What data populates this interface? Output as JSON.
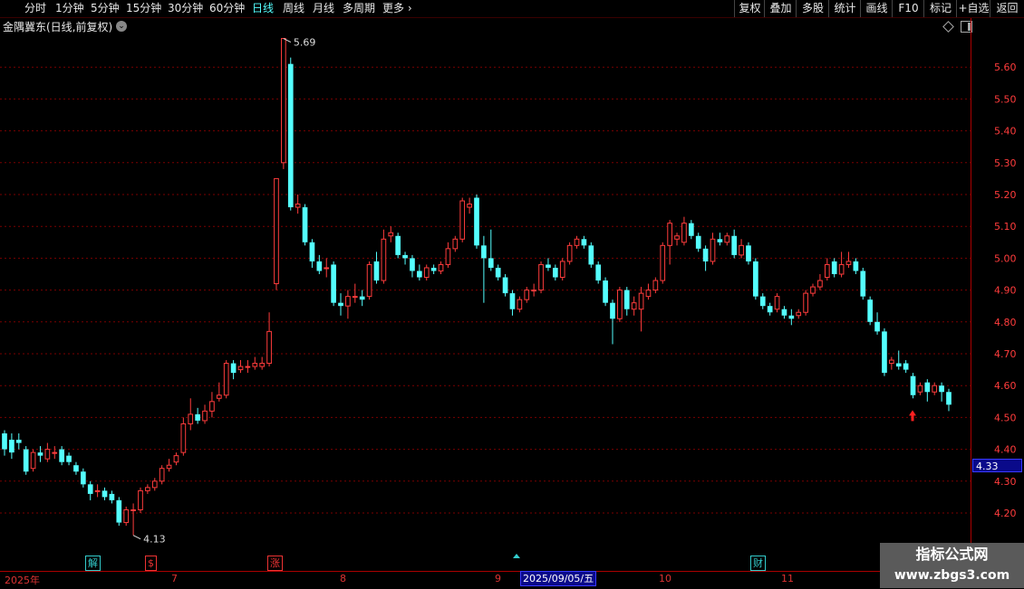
{
  "toolbar": {
    "periods": [
      "分时",
      "1分钟",
      "5分钟",
      "15分钟",
      "30分钟",
      "60分钟",
      "日线",
      "周线",
      "月线",
      "多周期",
      "更多"
    ],
    "active_period": "日线",
    "right_buttons": [
      "复权",
      "叠加",
      "多股",
      "统计",
      "画线",
      "F10",
      "标记",
      "+自选",
      "返回"
    ]
  },
  "chart_title": "金隅冀东(日线,前复权)",
  "price_tag": "4.33",
  "bottom": {
    "year_label": "2025年",
    "month_labels": [
      "7",
      "8",
      "9",
      "10",
      "11"
    ],
    "date_box": "2025/09/05/五"
  },
  "markers": [
    {
      "text": "解",
      "color": "#3cc"
    },
    {
      "text": "$",
      "color": "#e33"
    },
    {
      "text": "涨",
      "color": "#e33"
    },
    {
      "text": "财",
      "color": "#3cc"
    }
  ],
  "watermark": {
    "line1": "指标公式网",
    "line2": "www.zbgs3.com"
  },
  "colors": {
    "up": "#ff3c3c",
    "down": "#54ffff",
    "grid": "#7a0000",
    "axis": "#ff3c3c",
    "background": "#000000"
  },
  "chart_data": {
    "type": "candlestick",
    "yticks": [
      4.2,
      4.3,
      4.4,
      4.5,
      4.6,
      4.7,
      4.8,
      4.9,
      5.0,
      5.1,
      5.2,
      5.3,
      5.4,
      5.5,
      5.6
    ],
    "ylim": [
      4.1,
      5.75
    ],
    "high_annotation": "5.69",
    "low_annotation": "4.13",
    "candles": [
      [
        4.45,
        4.4,
        4.46,
        4.38
      ],
      [
        4.43,
        4.39,
        4.45,
        4.37
      ],
      [
        4.43,
        4.42,
        4.45,
        4.4
      ],
      [
        4.4,
        4.33,
        4.41,
        4.32
      ],
      [
        4.34,
        4.39,
        4.4,
        4.33
      ],
      [
        4.39,
        4.38,
        4.41,
        4.36
      ],
      [
        4.37,
        4.4,
        4.42,
        4.36
      ],
      [
        4.39,
        4.39,
        4.41,
        4.37
      ],
      [
        4.4,
        4.36,
        4.41,
        4.35
      ],
      [
        4.38,
        4.36,
        4.39,
        4.35
      ],
      [
        4.35,
        4.33,
        4.36,
        4.32
      ],
      [
        4.33,
        4.29,
        4.34,
        4.28
      ],
      [
        4.29,
        4.26,
        4.3,
        4.24
      ],
      [
        4.27,
        4.27,
        4.29,
        4.25
      ],
      [
        4.27,
        4.25,
        4.28,
        4.24
      ],
      [
        4.26,
        4.24,
        4.27,
        4.23
      ],
      [
        4.24,
        4.17,
        4.25,
        4.16
      ],
      [
        4.17,
        4.21,
        4.22,
        4.16
      ],
      [
        4.21,
        4.21,
        4.23,
        4.13
      ],
      [
        4.21,
        4.27,
        4.28,
        4.2
      ],
      [
        4.27,
        4.28,
        4.29,
        4.26
      ],
      [
        4.28,
        4.3,
        4.31,
        4.27
      ],
      [
        4.3,
        4.34,
        4.35,
        4.29
      ],
      [
        4.34,
        4.35,
        4.37,
        4.33
      ],
      [
        4.36,
        4.38,
        4.39,
        4.35
      ],
      [
        4.39,
        4.48,
        4.5,
        4.38
      ],
      [
        4.48,
        4.51,
        4.56,
        4.46
      ],
      [
        4.51,
        4.49,
        4.53,
        4.48
      ],
      [
        4.49,
        4.52,
        4.54,
        4.48
      ],
      [
        4.52,
        4.55,
        4.58,
        4.5
      ],
      [
        4.56,
        4.57,
        4.61,
        4.55
      ],
      [
        4.57,
        4.67,
        4.68,
        4.56
      ],
      [
        4.67,
        4.64,
        4.68,
        4.62
      ],
      [
        4.65,
        4.66,
        4.68,
        4.64
      ],
      [
        4.66,
        4.66,
        4.68,
        4.64
      ],
      [
        4.66,
        4.67,
        4.69,
        4.65
      ],
      [
        4.66,
        4.67,
        4.69,
        4.65
      ],
      [
        4.67,
        4.77,
        4.83,
        4.66
      ],
      [
        4.92,
        5.25,
        5.25,
        4.9
      ],
      [
        5.3,
        5.69,
        5.69,
        5.28
      ],
      [
        5.61,
        5.16,
        5.63,
        5.15
      ],
      [
        5.16,
        5.17,
        5.2,
        5.14
      ],
      [
        5.16,
        5.05,
        5.17,
        5.04
      ],
      [
        5.05,
        4.99,
        5.06,
        4.97
      ],
      [
        4.99,
        4.96,
        5.01,
        4.95
      ],
      [
        4.97,
        4.97,
        5.0,
        4.94
      ],
      [
        4.98,
        4.86,
        4.99,
        4.85
      ],
      [
        4.86,
        4.85,
        4.89,
        4.82
      ],
      [
        4.85,
        4.88,
        4.9,
        4.81
      ],
      [
        4.88,
        4.88,
        4.92,
        4.86
      ],
      [
        4.88,
        4.87,
        4.9,
        4.85
      ],
      [
        4.88,
        4.98,
        4.99,
        4.87
      ],
      [
        4.99,
        4.93,
        5.02,
        4.92
      ],
      [
        4.93,
        5.06,
        5.09,
        4.92
      ],
      [
        5.07,
        5.08,
        5.1,
        5.05
      ],
      [
        5.07,
        5.01,
        5.08,
        5.0
      ],
      [
        5.01,
        5.0,
        5.02,
        4.98
      ],
      [
        5.0,
        4.96,
        5.01,
        4.94
      ],
      [
        4.96,
        4.94,
        4.98,
        4.93
      ],
      [
        4.94,
        4.97,
        4.98,
        4.93
      ],
      [
        4.97,
        4.96,
        4.98,
        4.95
      ],
      [
        4.96,
        4.98,
        4.99,
        4.95
      ],
      [
        4.98,
        5.03,
        5.05,
        4.97
      ],
      [
        5.03,
        5.06,
        5.07,
        5.02
      ],
      [
        5.06,
        5.18,
        5.19,
        5.05
      ],
      [
        5.16,
        5.17,
        5.19,
        5.14
      ],
      [
        5.19,
        5.04,
        5.2,
        5.03
      ],
      [
        5.04,
        5.0,
        5.07,
        4.86
      ],
      [
        5.0,
        4.97,
        5.09,
        4.96
      ],
      [
        4.97,
        4.94,
        4.98,
        4.93
      ],
      [
        4.94,
        4.89,
        4.95,
        4.88
      ],
      [
        4.89,
        4.84,
        4.9,
        4.82
      ],
      [
        4.84,
        4.87,
        4.88,
        4.83
      ],
      [
        4.87,
        4.9,
        4.91,
        4.86
      ],
      [
        4.9,
        4.9,
        4.92,
        4.88
      ],
      [
        4.9,
        4.98,
        4.99,
        4.89
      ],
      [
        4.98,
        4.97,
        5.0,
        4.96
      ],
      [
        4.97,
        4.94,
        4.98,
        4.93
      ],
      [
        4.94,
        4.99,
        5.0,
        4.93
      ],
      [
        4.99,
        5.04,
        5.05,
        4.98
      ],
      [
        5.04,
        5.06,
        5.07,
        5.03
      ],
      [
        5.06,
        5.04,
        5.07,
        5.03
      ],
      [
        5.04,
        4.98,
        5.05,
        4.97
      ],
      [
        4.98,
        4.93,
        4.99,
        4.92
      ],
      [
        4.93,
        4.86,
        4.94,
        4.85
      ],
      [
        4.86,
        4.81,
        4.87,
        4.73
      ],
      [
        4.81,
        4.9,
        4.91,
        4.8
      ],
      [
        4.9,
        4.84,
        4.91,
        4.82
      ],
      [
        4.84,
        4.86,
        4.88,
        4.82
      ],
      [
        4.84,
        4.89,
        4.91,
        4.77
      ],
      [
        4.88,
        4.9,
        4.92,
        4.87
      ],
      [
        4.9,
        4.93,
        4.94,
        4.89
      ],
      [
        4.93,
        5.04,
        5.05,
        4.92
      ],
      [
        5.04,
        5.11,
        5.12,
        4.98
      ],
      [
        5.06,
        5.07,
        5.08,
        5.04
      ],
      [
        5.05,
        5.11,
        5.13,
        5.04
      ],
      [
        5.11,
        5.07,
        5.12,
        5.06
      ],
      [
        5.07,
        5.03,
        5.08,
        5.02
      ],
      [
        5.03,
        4.99,
        5.04,
        4.96
      ],
      [
        4.99,
        5.06,
        5.08,
        4.98
      ],
      [
        5.06,
        5.05,
        5.08,
        5.04
      ],
      [
        5.05,
        5.07,
        5.08,
        5.04
      ],
      [
        5.07,
        5.01,
        5.09,
        5.0
      ],
      [
        5.01,
        5.04,
        5.06,
        5.0
      ],
      [
        5.04,
        4.99,
        5.05,
        4.98
      ],
      [
        4.99,
        4.88,
        5.0,
        4.87
      ],
      [
        4.88,
        4.85,
        4.89,
        4.84
      ],
      [
        4.85,
        4.83,
        4.86,
        4.82
      ],
      [
        4.84,
        4.88,
        4.89,
        4.83
      ],
      [
        4.84,
        4.82,
        4.85,
        4.81
      ],
      [
        4.82,
        4.81,
        4.84,
        4.79
      ],
      [
        4.82,
        4.83,
        4.84,
        4.81
      ],
      [
        4.83,
        4.89,
        4.9,
        4.82
      ],
      [
        4.89,
        4.91,
        4.92,
        4.88
      ],
      [
        4.91,
        4.93,
        4.95,
        4.9
      ],
      [
        4.94,
        4.98,
        5.0,
        4.93
      ],
      [
        4.99,
        4.95,
        5.0,
        4.94
      ],
      [
        4.95,
        4.98,
        5.02,
        4.94
      ],
      [
        4.98,
        4.99,
        5.02,
        4.97
      ],
      [
        4.99,
        4.96,
        5.0,
        4.95
      ],
      [
        4.96,
        4.88,
        4.97,
        4.87
      ],
      [
        4.87,
        4.8,
        4.88,
        4.79
      ],
      [
        4.8,
        4.77,
        4.83,
        4.76
      ],
      [
        4.77,
        4.64,
        4.78,
        4.63
      ],
      [
        4.67,
        4.68,
        4.69,
        4.65
      ],
      [
        4.67,
        4.66,
        4.71,
        4.65
      ],
      [
        4.67,
        4.65,
        4.68,
        4.64
      ],
      [
        4.63,
        4.57,
        4.64,
        4.56
      ],
      [
        4.58,
        4.6,
        4.61,
        4.57
      ],
      [
        4.61,
        4.58,
        4.62,
        4.55
      ],
      [
        4.58,
        4.6,
        4.61,
        4.57
      ],
      [
        4.6,
        4.58,
        4.61,
        4.55
      ],
      [
        4.58,
        4.54,
        4.59,
        4.52
      ]
    ]
  }
}
